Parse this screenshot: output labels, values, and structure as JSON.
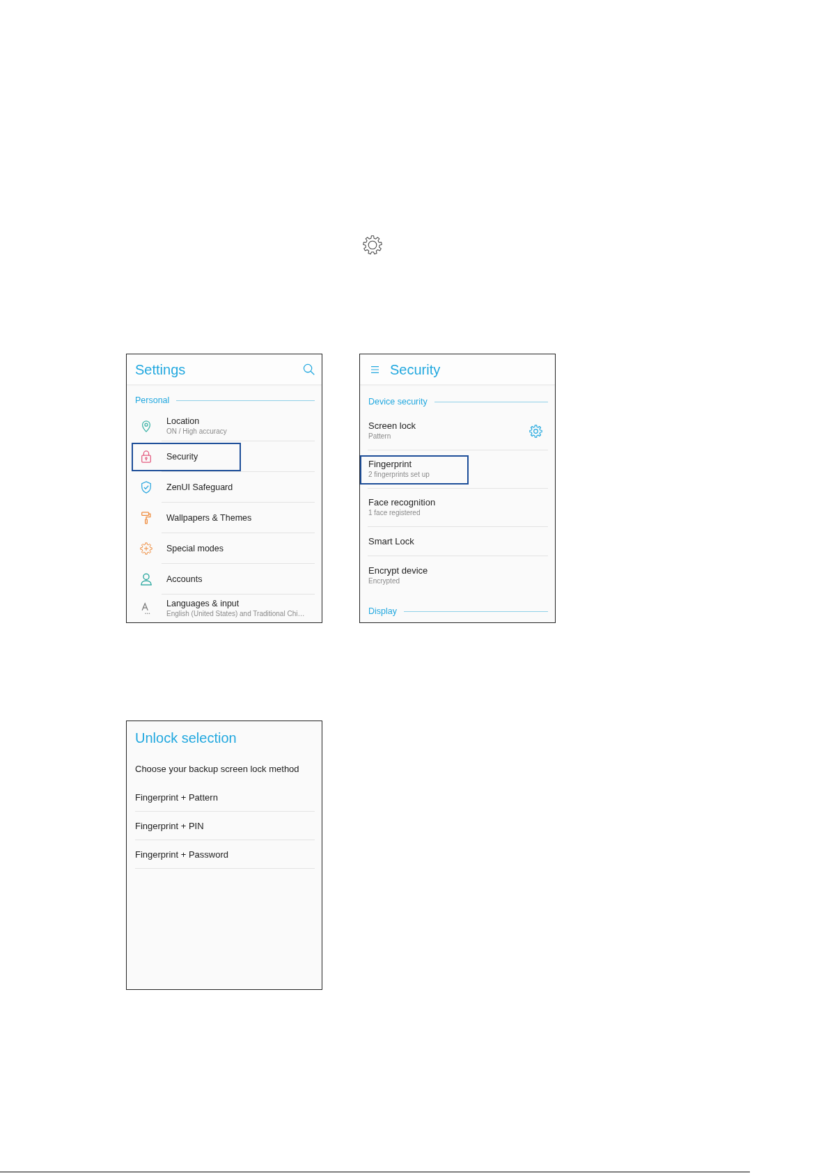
{
  "screens": [
    {
      "kind": "settings",
      "title": "Settings",
      "sections": [
        {
          "label": "Personal",
          "items": [
            {
              "title": "Location",
              "subtitle": "ON / High accuracy",
              "highlighted": false
            },
            {
              "title": "Security",
              "highlighted": true
            },
            {
              "title": "ZenUI Safeguard",
              "highlighted": false
            },
            {
              "title": "Wallpapers & Themes",
              "highlighted": false
            },
            {
              "title": "Special modes",
              "highlighted": false
            },
            {
              "title": "Accounts",
              "highlighted": false
            },
            {
              "title": "Languages & input",
              "subtitle": "English (United States) and Traditional Chi…",
              "highlighted": false
            }
          ]
        }
      ]
    },
    {
      "kind": "security",
      "title": "Security",
      "sections": [
        {
          "label": "Device security",
          "items": [
            {
              "kind": "gear",
              "title": "Screen lock",
              "subtitle": "Pattern",
              "highlighted": false
            },
            {
              "kind": "plain",
              "title": "Fingerprint",
              "subtitle": "2 fingerprints set up",
              "highlighted": true
            },
            {
              "kind": "plain",
              "title": "Face recognition",
              "subtitle": "1 face registered",
              "highlighted": false
            },
            {
              "kind": "plain",
              "title": "Smart Lock",
              "highlighted": false
            },
            {
              "kind": "plain",
              "title": "Encrypt device",
              "subtitle": "Encrypted",
              "highlighted": false
            }
          ]
        },
        {
          "label": "Display"
        }
      ]
    },
    {
      "kind": "selection",
      "title": "Unlock selection",
      "prompt": "Choose your backup screen lock method",
      "options": [
        "Fingerprint + Pattern",
        "Fingerprint + PIN",
        "Fingerprint + Password"
      ]
    }
  ]
}
